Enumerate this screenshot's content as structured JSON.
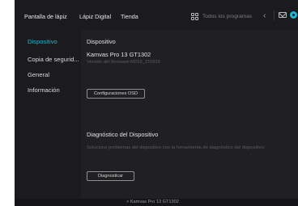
{
  "topbar": {
    "nav": [
      "Pantalla de lápiz",
      "Lápiz Digital",
      "Tienda"
    ],
    "programs_label": "Todos los programas"
  },
  "sidebar": {
    "items": [
      "Dispositivo",
      "Copia de segurid...",
      "General",
      "Información"
    ]
  },
  "panel": {
    "section1_title": "Dispositivo",
    "device_name": "Kamvas Pro 13 GT1302",
    "firmware": "Versión del firmware:M210_210916",
    "osd_button": "Configuraciones OSD",
    "section2_title": "Diagnóstico del Dispositivo",
    "diag_desc": "Solucione problemas del dispositivo con la herramienta de diagnóstico del dispositivo.",
    "diag_button": "Diagnosticar"
  },
  "bottombar": {
    "device": "> Kamvas Pro 13 GT1302"
  },
  "colors": {
    "accent": "#1fb8d4",
    "background": "#1b1b1e",
    "panel": "#202023"
  }
}
